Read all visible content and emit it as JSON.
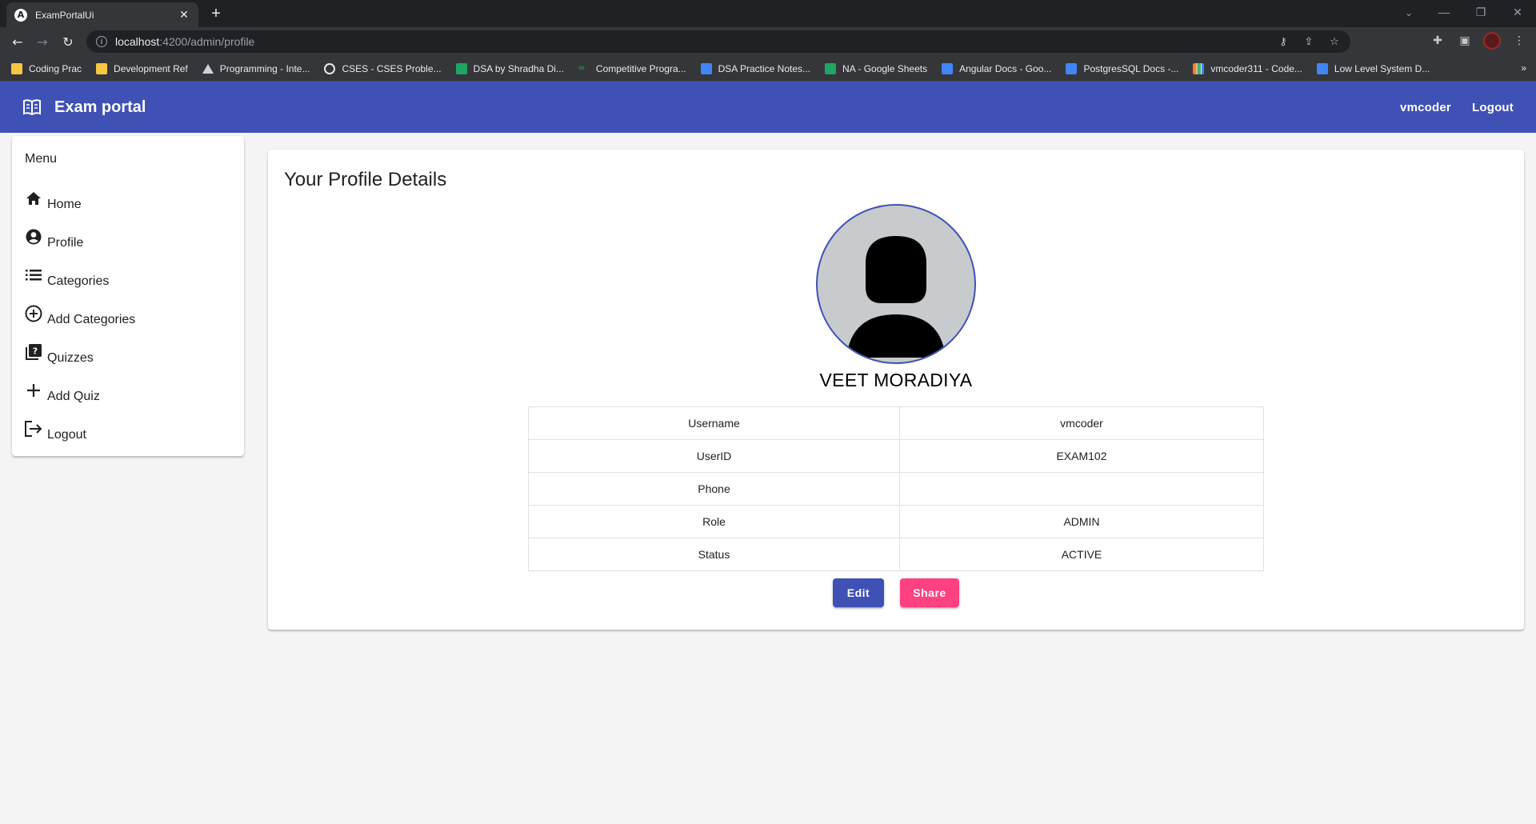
{
  "browser": {
    "tab_title": "ExamPortalUi",
    "tab_favicon_letter": "A",
    "url_host": "localhost",
    "url_rest": ":4200/admin/profile",
    "bookmarks": [
      {
        "label": "Coding Prac",
        "icon": "folder-icon"
      },
      {
        "label": "Development Ref",
        "icon": "folder-icon"
      },
      {
        "label": "Programming - Inte...",
        "icon": "mountain-icon"
      },
      {
        "label": "CSES - CSES Proble...",
        "icon": "globe-icon"
      },
      {
        "label": "DSA by Shradha Di...",
        "icon": "sheets-icon"
      },
      {
        "label": "Competitive Progra...",
        "icon": "gfg-icon"
      },
      {
        "label": "DSA Practice Notes...",
        "icon": "docs-icon"
      },
      {
        "label": "NA - Google Sheets",
        "icon": "sheets-icon"
      },
      {
        "label": "Angular Docs - Goo...",
        "icon": "docs-icon"
      },
      {
        "label": "PostgresSQL Docs -...",
        "icon": "docs-icon"
      },
      {
        "label": "vmcoder311 - Code...",
        "icon": "bar-icon"
      },
      {
        "label": "Low Level System D...",
        "icon": "docs-icon"
      }
    ],
    "bookmarks_overflow": "»"
  },
  "app": {
    "title": "Exam portal",
    "nav_user": "vmcoder",
    "nav_logout": "Logout",
    "brand_color": "#3f51b5",
    "accent_color": "#ff4081"
  },
  "sidebar": {
    "heading": "Menu",
    "items": [
      {
        "label": "Home",
        "icon": "home-icon"
      },
      {
        "label": "Profile",
        "icon": "account-circle-icon"
      },
      {
        "label": "Categories",
        "icon": "list-icon"
      },
      {
        "label": "Add Categories",
        "icon": "add-circle-icon"
      },
      {
        "label": "Quizzes",
        "icon": "quiz-icon"
      },
      {
        "label": "Add Quiz",
        "icon": "add-icon"
      },
      {
        "label": "Logout",
        "icon": "logout-icon"
      }
    ]
  },
  "profile": {
    "card_title": "Your Profile Details",
    "name": "VEET MORADIYA",
    "rows": [
      {
        "key": "Username",
        "value": "vmcoder"
      },
      {
        "key": "UserID",
        "value": "EXAM102"
      },
      {
        "key": "Phone",
        "value": ""
      },
      {
        "key": "Role",
        "value": "ADMIN"
      },
      {
        "key": "Status",
        "value": "ACTIVE"
      }
    ],
    "edit_label": "Edit",
    "share_label": "Share"
  }
}
